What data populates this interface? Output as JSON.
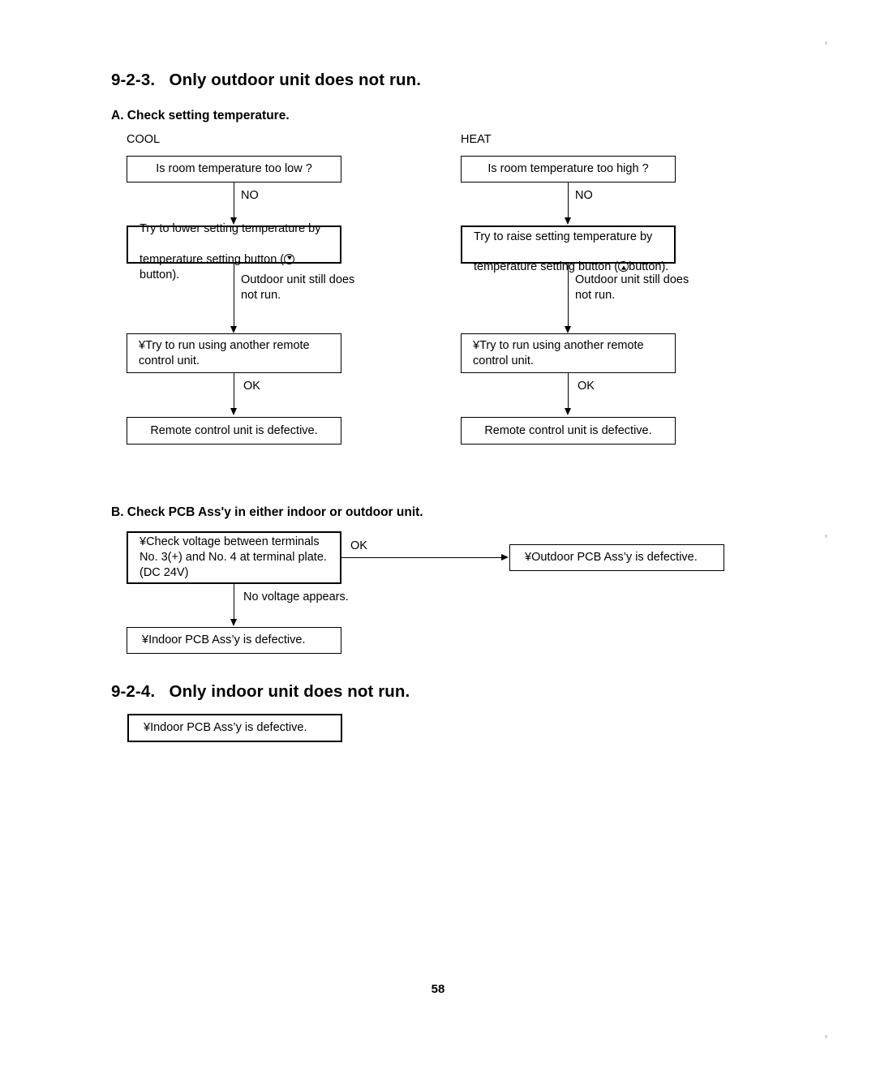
{
  "page": {
    "number": "58"
  },
  "section_9_2_3": {
    "heading": "9-2-3.   Only outdoor unit does not run.",
    "part_a": {
      "heading": "A. Check setting temperature.",
      "cool": {
        "mode_label": "COOL",
        "box1": "Is room temperature too low ?",
        "edge1": "NO",
        "box2_line1": "Try to lower setting temperature by",
        "box2_line2_pre": "temperature setting button (",
        "box2_line2_post": " button).",
        "box2_button_icon": "circle-down-triangle-icon",
        "edge2": "Outdoor unit still does\nnot run.",
        "box3": "¥Try to run using another remote\n control unit.",
        "edge3": "OK",
        "box4": "Remote control unit is defective."
      },
      "heat": {
        "mode_label": "HEAT",
        "box1": "Is room temperature too high ?",
        "edge1": "NO",
        "box2_line1": "Try to raise setting temperature by",
        "box2_line2_pre": "temperature setting button (",
        "box2_line2_post": "button).",
        "box2_button_icon": "circle-up-triangle-icon",
        "edge2": "Outdoor unit still does\nnot run.",
        "box3": "¥Try to run using another remote\n control unit.",
        "edge3": "OK",
        "box4": "Remote control unit is defective."
      }
    },
    "part_b": {
      "heading": "B. Check PCB Ass'y in either indoor or outdoor unit.",
      "box1": "¥Check voltage between terminals\n  No. 3(+) and No. 4 at terminal plate.\n  (DC 24V)",
      "edge_ok": "OK",
      "box_outdoor": "¥Outdoor PCB Ass’y is defective.",
      "edge_no_voltage": "No voltage appears.",
      "box_indoor": "¥Indoor PCB Ass’y is defective."
    }
  },
  "section_9_2_4": {
    "heading": "9-2-4.   Only indoor unit does not run.",
    "box": "¥Indoor PCB Ass’y is defective."
  }
}
